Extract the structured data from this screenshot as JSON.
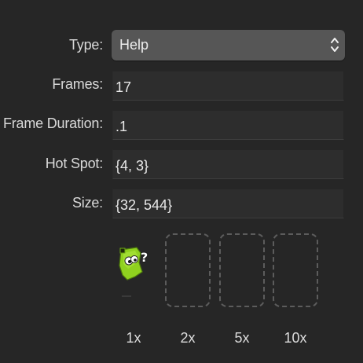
{
  "form": {
    "type_label": "Type:",
    "type_value": "Help",
    "frames_label": "Frames:",
    "frames_value": "17",
    "frame_duration_label": "Frame Duration:",
    "frame_duration_value": ".1",
    "hot_spot_label": "Hot Spot:",
    "hot_spot_value": "{4, 3}",
    "size_label": "Size:",
    "size_value": "{32, 544}"
  },
  "preview": {
    "cursor_icon": "help-cursor-icon",
    "scales": [
      "1x",
      "2x",
      "5x",
      "10x"
    ]
  },
  "colors": {
    "background": "#262626",
    "field": "#2d2d2d",
    "select": "#565656",
    "cursor_green": "#8fd11f",
    "slot_border": "#5c5c5c"
  }
}
